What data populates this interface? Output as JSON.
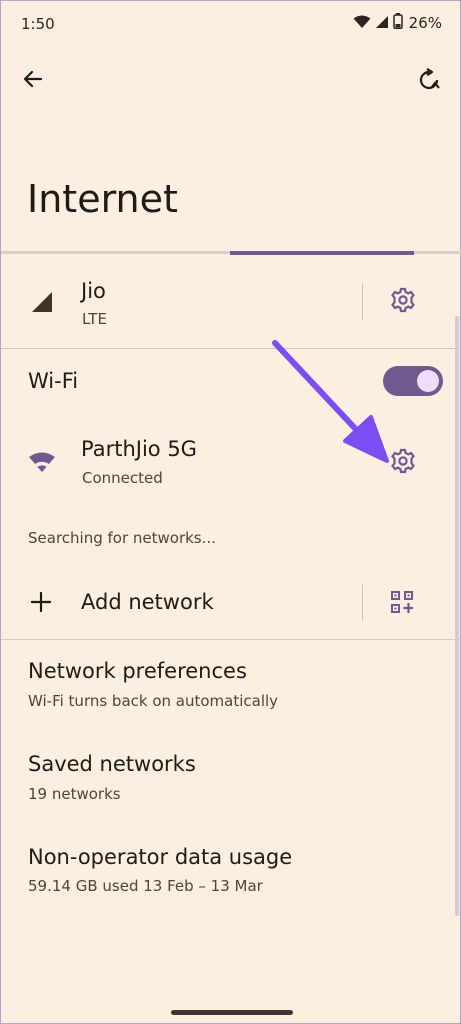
{
  "status_bar": {
    "time": "1:50",
    "battery": "26%",
    "icons": [
      "wifi-icon",
      "cell-signal-icon",
      "battery-icon"
    ]
  },
  "toolbar": {
    "back_icon": "back-arrow-icon",
    "action_icon": "refresh-icon"
  },
  "page": {
    "title": "Internet"
  },
  "mobile": {
    "name": "Jio",
    "type": "LTE",
    "icon": "cell-signal-icon",
    "settings_icon": "gear-icon"
  },
  "wifi": {
    "label": "Wi-Fi",
    "enabled": true,
    "connected_network": {
      "name": "ParthJio 5G",
      "status": "Connected",
      "icon": "wifi-icon",
      "settings_icon": "gear-icon"
    },
    "searching_text": "Searching for networks..."
  },
  "add_network": {
    "label": "Add network",
    "icon": "plus-icon",
    "qr_icon": "qr-code-icon"
  },
  "settings_list": [
    {
      "title": "Network preferences",
      "subtitle": "Wi-Fi turns back on automatically"
    },
    {
      "title": "Saved networks",
      "subtitle": "19 networks"
    },
    {
      "title": "Non-operator data usage",
      "subtitle": "59.14 GB used 13 Feb – 13 Mar"
    }
  ],
  "colors": {
    "background": "#faefe1",
    "accent": "#6f5a8f",
    "annotation_arrow": "#7b4df2"
  }
}
